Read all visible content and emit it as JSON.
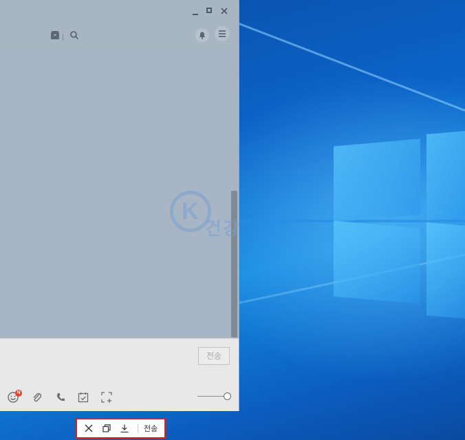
{
  "window": {
    "controls": {
      "minimize": "minimize-icon",
      "maximize": "maximize-icon",
      "close": "close-icon"
    },
    "toolbar_icons": [
      "drawer-icon",
      "search-icon",
      "bell-icon",
      "menu-icon"
    ],
    "input": {
      "send_label": "전송"
    },
    "bottom_icons": [
      "emoji-icon",
      "clip-icon",
      "phone-icon",
      "calendar-icon",
      "capture-icon"
    ],
    "emoji_badge": "N"
  },
  "watermark": {
    "letter": "K",
    "text": "건강",
    "small": ""
  },
  "capture_toolbar": {
    "send_label": "전송",
    "icons": [
      "close-icon",
      "copy-icon",
      "download-icon"
    ]
  },
  "colors": {
    "accent_red": "#e21b1b",
    "badge_red": "#e0412c",
    "overlay": "#a8b5c4"
  }
}
